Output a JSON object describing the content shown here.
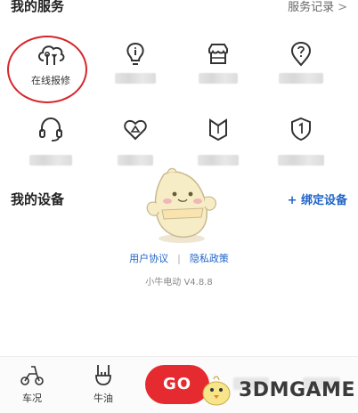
{
  "services": {
    "title": "我的服务",
    "record_link": "服务记录",
    "record_chevron": ">",
    "items": [
      {
        "icon": "cloud-repair-icon",
        "label": "在线报修"
      },
      {
        "icon": "lightbulb-icon",
        "label": ""
      },
      {
        "icon": "store-icon",
        "label": ""
      },
      {
        "icon": "help-location-icon",
        "label": ""
      },
      {
        "icon": "headset-icon",
        "label": ""
      },
      {
        "icon": "heart-warning-icon",
        "label": ""
      },
      {
        "icon": "shield-badge-icon",
        "label": ""
      },
      {
        "icon": "shield-1-icon",
        "label": ""
      }
    ]
  },
  "devices": {
    "title": "我的设备",
    "add_link": "+ 绑定设备"
  },
  "footer": {
    "user_agreement": "用户协议",
    "separator": "|",
    "privacy_policy": "隐私政策",
    "version": "小牛电动 V4.8.8"
  },
  "tabbar": {
    "tabs": [
      {
        "icon": "scooter-icon",
        "label": "车况"
      },
      {
        "icon": "rock-hand-icon",
        "label": "牛油"
      }
    ],
    "go_label": "GO",
    "watermark": "3DMGAME"
  },
  "colors": {
    "accent_red": "#e52b2f",
    "link_blue": "#1f64c8"
  }
}
